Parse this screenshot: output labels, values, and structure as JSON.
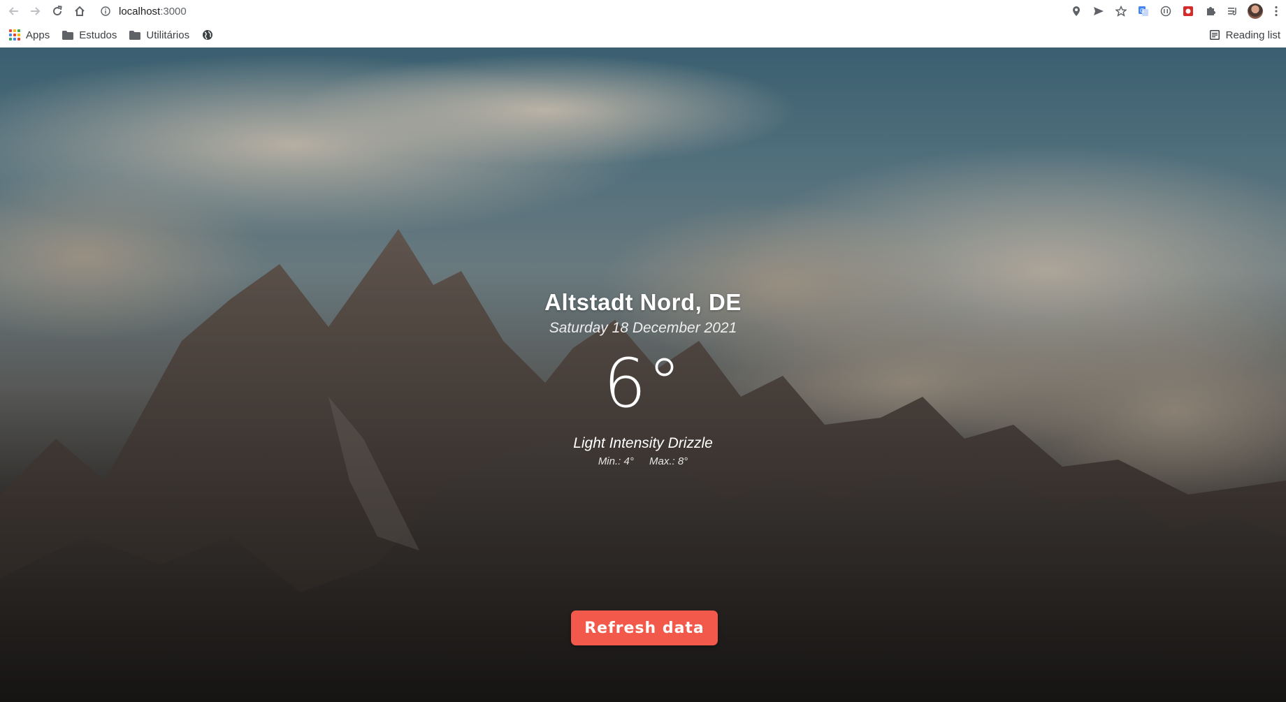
{
  "browser": {
    "url_host": "localhost",
    "url_port": ":3000"
  },
  "bookmarks": {
    "apps": "Apps",
    "items": [
      "Estudos",
      "Utilitários"
    ],
    "reading_list": "Reading list"
  },
  "weather": {
    "location": "Altstadt Nord, DE",
    "date": "Saturday 18 December 2021",
    "temperature": "6°",
    "description": "Light Intensity Drizzle",
    "min": "Min.: 4°",
    "max": "Max.: 8°"
  },
  "actions": {
    "refresh_label": "Refresh data"
  },
  "colors": {
    "accent": "#f2594b"
  }
}
